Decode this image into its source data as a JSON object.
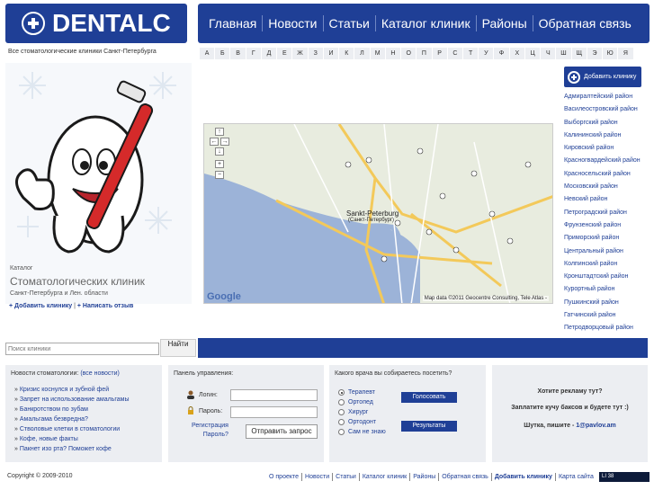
{
  "logo": {
    "text": "DENTALC"
  },
  "nav": [
    "Главная",
    "Новости",
    "Статьи",
    "Каталог клиник",
    "Районы",
    "Обратная связь"
  ],
  "tagline": "Все стоматологические клиники Санкт-Петербурга",
  "alphabet": [
    "А",
    "Б",
    "В",
    "Г",
    "Д",
    "Е",
    "Ж",
    "З",
    "И",
    "К",
    "Л",
    "М",
    "Н",
    "О",
    "П",
    "Р",
    "С",
    "Т",
    "У",
    "Ф",
    "Х",
    "Ц",
    "Ч",
    "Ш",
    "Щ",
    "Э",
    "Ю",
    "Я"
  ],
  "promo": {
    "catalog_label": "Каталог",
    "catalog_title": "Стоматологических клиник",
    "catalog_sub": "Санкт-Петербурга и Лен. области",
    "add_link": "+ Добавить клинику",
    "write_link": "+ Написать отзыв"
  },
  "map": {
    "copyright": "Map data ©2011 Geocentre Consulting, Tele Atlas -",
    "google": "Google",
    "city": "Sankt-Peterburg",
    "city_sub": "(Санкт-Петербург)"
  },
  "sidebar": {
    "add_clinic": "Добавить клинику",
    "districts": [
      "Адмиралтейский район",
      "Василеостровский район",
      "Выборгский район",
      "Калининский район",
      "Кировский район",
      "Красногвардейский район",
      "Красносельский район",
      "Московский район",
      "Невский район",
      "Петроградский район",
      "Фрунзенский район",
      "Приморский район",
      "Центральный район",
      "Колпинский район",
      "Кронштадтский район",
      "Курортный район",
      "Пушкинский район",
      "Гатчинский район",
      "Петродворцовый район"
    ]
  },
  "search": {
    "placeholder": "Поиск клиники",
    "button": "Найти"
  },
  "news": {
    "title": "Новости стоматологии:",
    "all_link": "(все новости)",
    "items": [
      "Кризис коснулся и зубной фей",
      "Запрет на использование амальгамы",
      "Банкротством по зубам",
      "Амальгама безвредна?",
      "Стволовые клетки в стоматологии",
      "Кофе, новые факты",
      "Пакнет изо рта? Поможет кофе"
    ]
  },
  "login": {
    "title": "Панель управления:",
    "login_label": "Логин:",
    "password_label": "Пароль:",
    "register": "Регистрация",
    "forgot": "Пароль?",
    "send": "Отправить запрос"
  },
  "poll": {
    "title": "Какого врача вы собираетесь посетить?",
    "options": [
      "Терапевт",
      "Ортопед",
      "Хирург",
      "Ортодонт",
      "Сам не знаю"
    ],
    "vote": "Голосовать",
    "results": "Результаты"
  },
  "ad": {
    "line1": "Хотите рекламу тут?",
    "line2": "Заплатите кучу баксов и будете тут :)",
    "line3": "Шутка, пишите -",
    "email": "1@pavlov.am"
  },
  "footer": {
    "copyright": "Copyright © 2009-2010",
    "links": [
      "О проекте",
      "Новости",
      "Статьи",
      "Каталог клиник",
      "Районы",
      "Обратная связь",
      "Добавить клинику",
      "Карта сайта"
    ],
    "counter": "LI 38"
  }
}
